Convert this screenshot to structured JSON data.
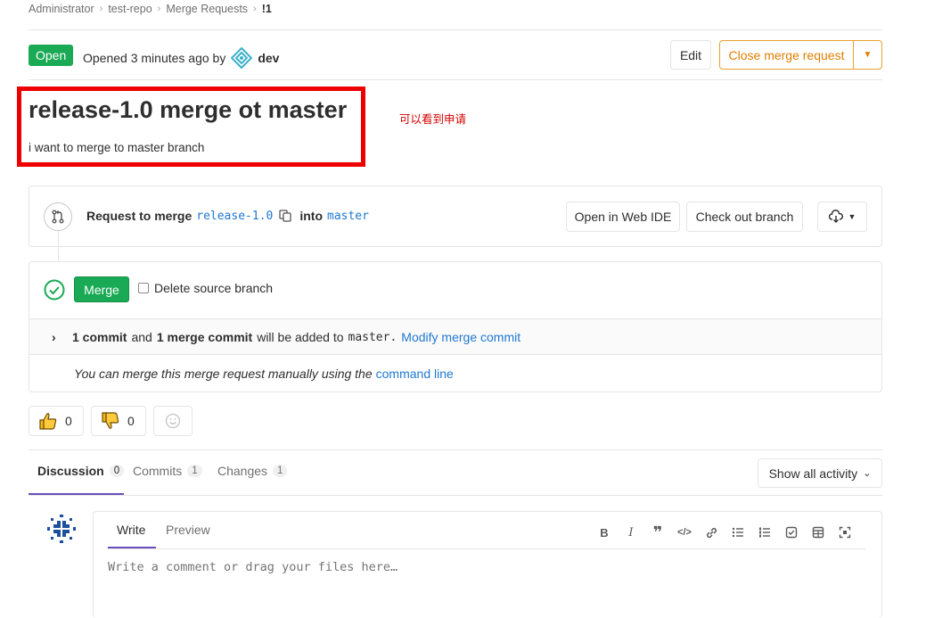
{
  "breadcrumb": [
    "Administrator",
    "test-repo",
    "Merge Requests",
    "!1"
  ],
  "header": {
    "status": "Open",
    "opened_text": "Opened 3 minutes ago by",
    "author": "dev",
    "edit_label": "Edit",
    "close_label": "Close merge request"
  },
  "mr": {
    "title": "release-1.0 merge ot master",
    "description": "i want to merge to master branch"
  },
  "annotation": {
    "text": "可以看到申请",
    "color": "#ee0000"
  },
  "request": {
    "prefix": "Request to merge",
    "source_branch": "release-1.0",
    "into": "into",
    "target_branch": "master",
    "open_ide_label": "Open in Web IDE",
    "checkout_label": "Check out branch"
  },
  "merge_widget": {
    "merge_label": "Merge",
    "delete_source_label": "Delete source branch",
    "commit_count": "1 commit",
    "and": "and",
    "merge_commit": "1 merge commit",
    "will_be_added": "will be added to",
    "target": "master.",
    "modify_link": "Modify merge commit",
    "manual_text": "You can merge this merge request manually using the",
    "command_line_link": "command line"
  },
  "awards": {
    "thumbs_up": "0",
    "thumbs_down": "0"
  },
  "tabs": [
    {
      "label": "Discussion",
      "count": "0"
    },
    {
      "label": "Commits",
      "count": "1"
    },
    {
      "label": "Changes",
      "count": "1"
    }
  ],
  "activity_filter": "Show all activity",
  "comment": {
    "write_tab": "Write",
    "preview_tab": "Preview",
    "placeholder": "Write a comment or drag your files here…"
  },
  "colors": {
    "success": "#1aaa55",
    "warning": "#de7e00",
    "link": "#1f78d1",
    "tab_active": "#6b4fbb"
  },
  "icons": [
    "chevron-right-icon",
    "merge-request-icon",
    "copy-icon",
    "cloud-download-icon",
    "check-circle-icon",
    "thumbs-up-icon",
    "thumbs-down-icon",
    "smiley-icon",
    "chevron-down-icon",
    "bold-icon",
    "italic-icon",
    "quote-icon",
    "code-icon",
    "link-icon",
    "bullet-list-icon",
    "numbered-list-icon",
    "task-list-icon",
    "table-icon",
    "fullscreen-icon"
  ]
}
